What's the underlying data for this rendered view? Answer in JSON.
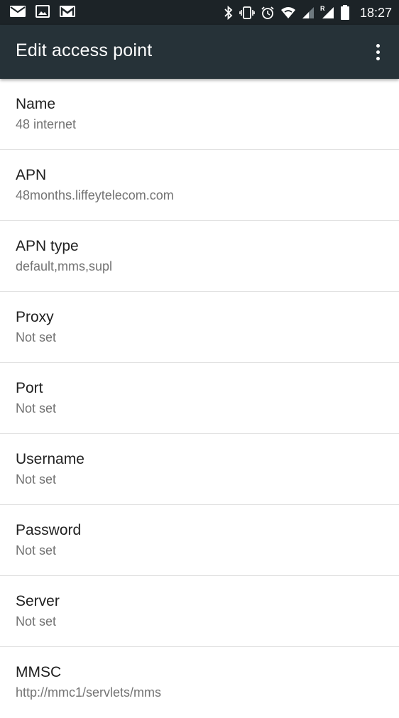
{
  "status_bar": {
    "time": "18:27",
    "left_icons": [
      "email-icon",
      "image-icon",
      "gmail-icon"
    ],
    "right_icons": [
      "bluetooth-icon",
      "vibrate-icon",
      "alarm-icon",
      "wifi-icon",
      "signal-icon",
      "roaming-signal-icon",
      "battery-icon"
    ],
    "roaming_label": "R"
  },
  "app_bar": {
    "title": "Edit access point",
    "overflow_icon": "more-vert-icon"
  },
  "preferences": [
    {
      "title": "Name",
      "summary": "48 internet"
    },
    {
      "title": "APN",
      "summary": "48months.liffeytelecom.com"
    },
    {
      "title": "APN type",
      "summary": "default,mms,supl"
    },
    {
      "title": "Proxy",
      "summary": "Not set"
    },
    {
      "title": "Port",
      "summary": "Not set"
    },
    {
      "title": "Username",
      "summary": "Not set"
    },
    {
      "title": "Password",
      "summary": "Not set"
    },
    {
      "title": "Server",
      "summary": "Not set"
    },
    {
      "title": "MMSC",
      "summary": "http://mmc1/servlets/mms"
    }
  ],
  "colors": {
    "status_bar": "#1c2327",
    "app_bar": "#263238",
    "title_text": "#212121",
    "summary_text": "#737373",
    "divider": "#e2e2e2"
  }
}
